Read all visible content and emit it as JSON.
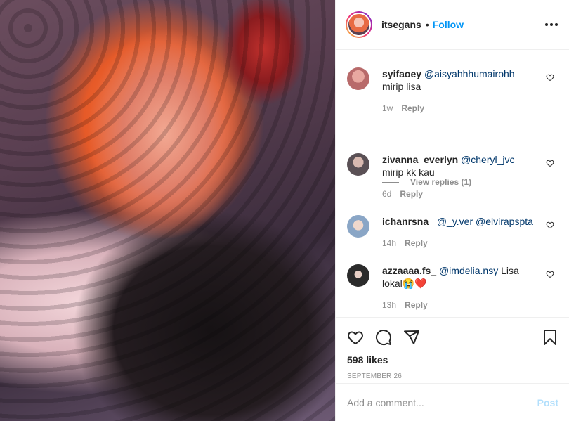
{
  "header": {
    "username": "itsegans",
    "separator": "•",
    "follow_label": "Follow"
  },
  "comments": [
    {
      "username": "syifaoey",
      "mention": "@aisyahhhumairohh",
      "text": "mirip lisa",
      "time": "1w",
      "reply_label": "Reply",
      "avatar_color": "#b86a6a"
    },
    {
      "username": "zivanna_everlyn",
      "mention": "@cheryl_jvc",
      "text": "mirip kk kau",
      "time": "6d",
      "reply_label": "Reply",
      "avatar_color": "#5a5055"
    },
    {
      "username": "ichanrsna_",
      "mention": "@_y.ver @elvirapspta",
      "text": "",
      "time": "14h",
      "reply_label": "Reply",
      "avatar_color": "#8aa6c6"
    },
    {
      "username": "azzaaaa.fs_",
      "mention": "@imdelia.nsy",
      "text": "Lisa lokal😭❤️",
      "time": "13h",
      "reply_label": "Reply",
      "avatar_color": "#2b2b2b"
    }
  ],
  "view_replies": "View replies (1)",
  "actions": {
    "likes": "598 likes",
    "date": "SEPTEMBER 26"
  },
  "add_comment": {
    "placeholder": "Add a comment...",
    "post_label": "Post"
  },
  "icons": {
    "like": "heart-icon",
    "comment": "comment-icon",
    "share": "share-icon",
    "save": "bookmark-icon",
    "more": "more-options-icon"
  },
  "colors": {
    "accent": "#0095f6",
    "post_disabled": "#b2dffc",
    "text": "#262626",
    "muted": "#8e8e8e"
  }
}
